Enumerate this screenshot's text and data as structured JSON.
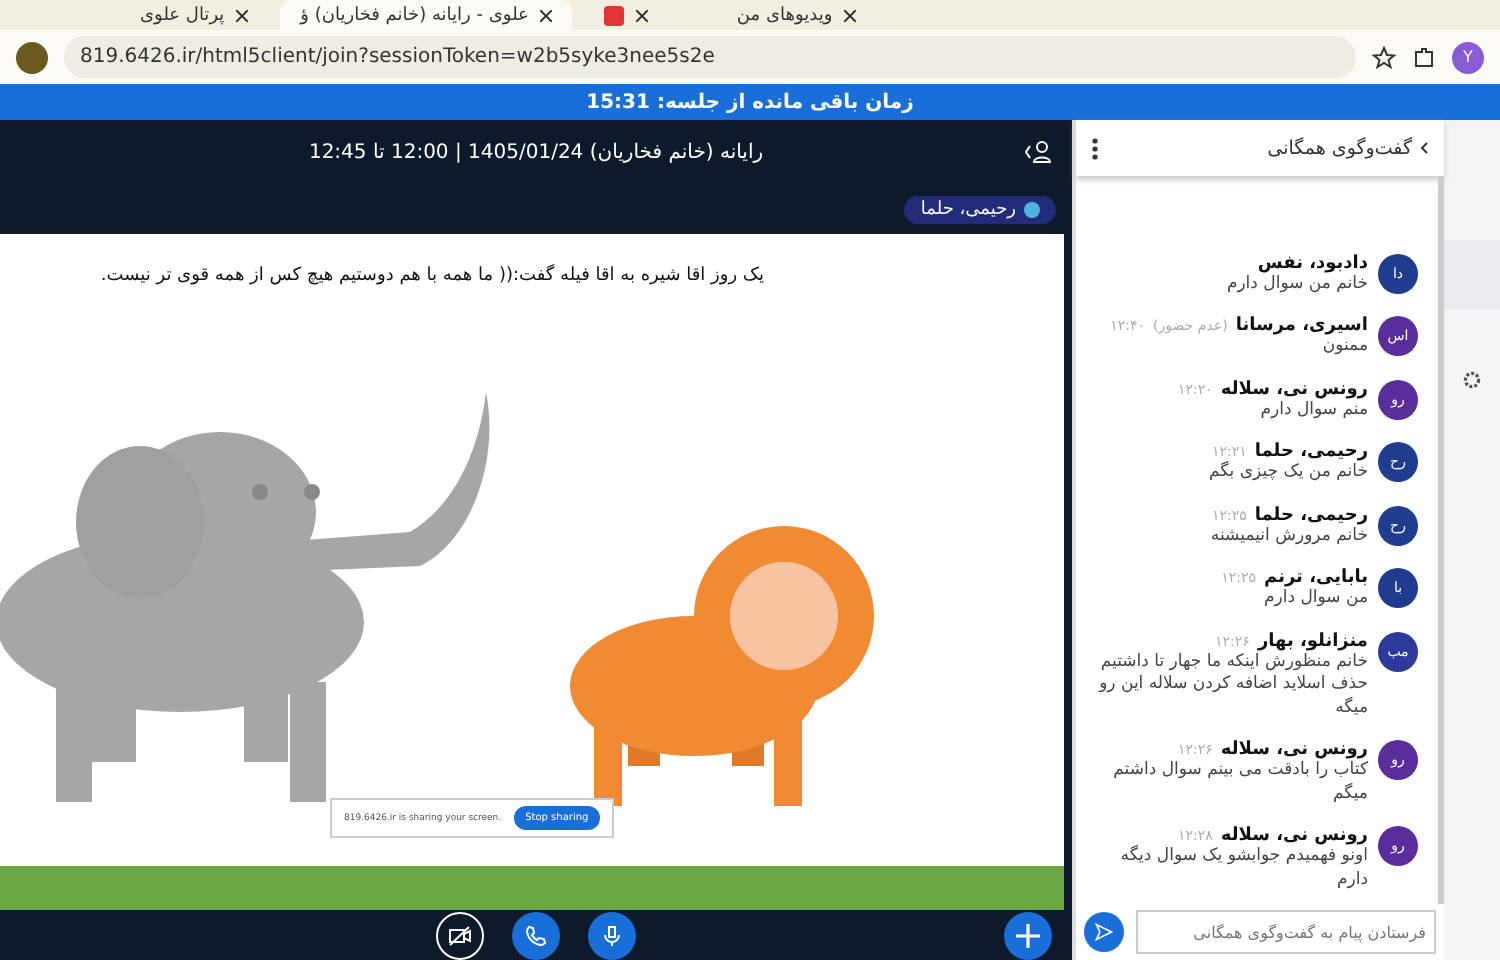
{
  "browser": {
    "tabs": [
      {
        "title": "ویدیوهای من",
        "selected": false
      },
      {
        "selected": false
      },
      {
        "title": "علوی - رایانه (خانم فخاریان) ؤ",
        "selected": true
      },
      {
        "title": "پرتال علوی",
        "selected": false
      }
    ],
    "url": "819.6426.ir/html5client/join?sessionToken=w2b5syke3nee5s2e",
    "profile": "Y"
  },
  "banner": "زمان باقی مانده از جلسه: 15:31",
  "meeting": {
    "title": "رایانه (خانم فخاریان) 1405/01/24 | 12:00 تا 12:45",
    "presenter": "رحیمی، حلما"
  },
  "slide": {
    "text": "یک روز اقا شیره به اقا فیله گفت:(( ما همه با هم دوستیم هیچ کس از همه قوی تر نیست.",
    "share_notice": "819.6426.ir is sharing your screen.",
    "stop_button": "Stop sharing"
  },
  "chat": {
    "title": "گفت‌وگوی همگانی",
    "placeholder": "فرستادن پیام به گفت‌وگوی همگانی",
    "messages": [
      {
        "avatar": "دا",
        "color": "#1f3c8f",
        "name": "دادبود، نفس",
        "text": "خانم من سوال دارم"
      },
      {
        "avatar": "اس",
        "color": "#5a2d9c",
        "name": "اسیری، مرسانا",
        "status": "(عدم حضور)",
        "time": "۱۲:۴۰",
        "text": "ممنون"
      },
      {
        "avatar": "رو",
        "color": "#5a2d9c",
        "name": "رونس نی، سلاله",
        "time": "۱۲:۲۰",
        "text": "منم سوال دارم"
      },
      {
        "avatar": "رح",
        "color": "#1f3c8f",
        "name": "رحیمی، حلما",
        "time": "۱۲:۲۱",
        "text": "خانم من یک چیزی بگم"
      },
      {
        "avatar": "رح",
        "color": "#1f3c8f",
        "name": "رحیمی، حلما",
        "time": "۱۲:۲۵",
        "text": "خانم مرورش انیمیشنه"
      },
      {
        "avatar": "با",
        "color": "#1f3c8f",
        "name": "بابایی، ترنم",
        "time": "۱۲:۲۵",
        "text": "من سوال دارم"
      },
      {
        "avatar": "مب",
        "color": "#2e3a9a",
        "name": "منزانلو، بهار",
        "time": "۱۲:۲۶",
        "text": "خانم منظورش اینکه ما جهار تا داشتیم حذف اسلاید اضافه کردن سلاله این رو میگه"
      },
      {
        "avatar": "رو",
        "color": "#5a2d9c",
        "name": "رونس نی، سلاله",
        "time": "۱۲:۲۶",
        "text": "کتاب را بادقت می بینم سوال داشتم میگم"
      },
      {
        "avatar": "رو",
        "color": "#5a2d9c",
        "name": "رونس نی، سلاله",
        "time": "۱۲:۲۸",
        "text": "اونو فهمیدم جوابشو یک سوال دیگه دارم"
      }
    ]
  }
}
